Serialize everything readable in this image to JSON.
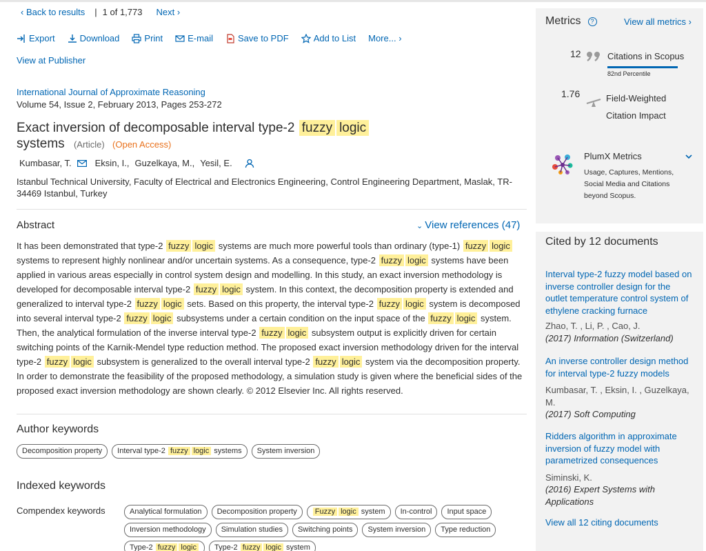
{
  "nav": {
    "back": "Back to results",
    "position": "1",
    "of_label": "of",
    "total": "1,773",
    "next": "Next"
  },
  "toolbar": {
    "export": "Export",
    "download": "Download",
    "print": "Print",
    "email": "E-mail",
    "save_pdf": "Save to PDF",
    "add_list": "Add to List",
    "more": "More..."
  },
  "view_publisher": "View at Publisher",
  "journal": "International Journal of Approximate Reasoning",
  "volume": "Volume 54, Issue 2, February 2013, Pages 253-272",
  "title": {
    "part1": "Exact inversion of decomposable interval type-2",
    "hl1": "fuzzy",
    "hl2": "logic",
    "part2": "systems",
    "article": "(Article)",
    "open_access": "(Open Access)"
  },
  "authors": [
    "Kumbasar, T.",
    "Eksin, I.,",
    "Guzelkaya, M.,",
    "Yesil, E."
  ],
  "affiliation": "Istanbul Technical University, Faculty of Electrical and Electronics Engineering, Control Engineering Department, Maslak, TR-34469 Istanbul, Turkey",
  "abstract": {
    "heading": "Abstract",
    "view_refs": "View references (47)",
    "segments": [
      {
        "t": "It has been demonstrated that type-2 "
      },
      {
        "h": "fuzzy"
      },
      {
        "h": "logic"
      },
      {
        "t": " systems are much more powerful tools than ordinary (type-1) "
      },
      {
        "h": "fuzzy"
      },
      {
        "h": "logic"
      },
      {
        "t": " systems to represent highly nonlinear and/or uncertain systems. As a consequence, type-2 "
      },
      {
        "h": "fuzzy"
      },
      {
        "h": "logic"
      },
      {
        "t": " systems have been applied in various areas especially in control system design and modelling. In this study, an exact inversion methodology is developed for decomposable interval type-2 "
      },
      {
        "h": "fuzzy"
      },
      {
        "h": "logic"
      },
      {
        "t": " system. In this context, the decomposition property is extended and generalized to interval type-2 "
      },
      {
        "h": "fuzzy"
      },
      {
        "h": "logic"
      },
      {
        "t": " sets. Based on this property, the interval type-2 "
      },
      {
        "h": "fuzzy"
      },
      {
        "h": "logic"
      },
      {
        "t": " system is decomposed into several interval type-2 "
      },
      {
        "h": "fuzzy"
      },
      {
        "h": "logic"
      },
      {
        "t": " subsystems under a certain condition on the input space of the "
      },
      {
        "h": "fuzzy"
      },
      {
        "h": "logic"
      },
      {
        "t": " system. Then, the analytical formulation of the inverse interval type-2 "
      },
      {
        "h": "fuzzy"
      },
      {
        "h": "logic"
      },
      {
        "t": " subsystem output is explicitly driven for certain switching points of the Karnik-Mendel type reduction method. The proposed exact inversion methodology driven for the interval type-2 "
      },
      {
        "h": "fuzzy"
      },
      {
        "h": "logic"
      },
      {
        "t": " subsystem is generalized to the overall interval type-2 "
      },
      {
        "h": "fuzzy"
      },
      {
        "h": "logic"
      },
      {
        "t": " system via the decomposition property. In order to demonstrate the feasibility of the proposed methodology, a simulation study is given where the beneficial sides of the proposed exact inversion methodology are shown clearly. © 2012 Elsevier Inc. All rights reserved."
      }
    ]
  },
  "author_keywords": {
    "heading": "Author keywords",
    "items": [
      [
        {
          "t": "Decomposition property"
        }
      ],
      [
        {
          "t": "Interval type-2 "
        },
        {
          "h": "fuzzy"
        },
        {
          "h": "logic"
        },
        {
          "t": " systems"
        }
      ],
      [
        {
          "t": "System inversion"
        }
      ]
    ]
  },
  "indexed_keywords": {
    "heading": "Indexed keywords",
    "compendex_label": "Compendex keywords",
    "items": [
      [
        {
          "t": "Analytical formulation"
        }
      ],
      [
        {
          "t": "Decomposition property"
        }
      ],
      [
        {
          "h": "Fuzzy"
        },
        {
          "h": "logic"
        },
        {
          "t": " system"
        }
      ],
      [
        {
          "t": "In-control"
        }
      ],
      [
        {
          "t": "Input space"
        }
      ],
      [
        {
          "t": "Inversion methodology"
        }
      ],
      [
        {
          "t": "Simulation studies"
        }
      ],
      [
        {
          "t": "Switching points"
        }
      ],
      [
        {
          "t": "System inversion"
        }
      ],
      [
        {
          "t": "Type reduction"
        }
      ],
      [
        {
          "t": "Type-2 "
        },
        {
          "h": "fuzzy"
        },
        {
          "h": "logic"
        }
      ],
      [
        {
          "t": "Type-2 "
        },
        {
          "h": "fuzzy"
        },
        {
          "h": "logic"
        },
        {
          "t": " system"
        }
      ]
    ]
  },
  "metrics": {
    "heading": "Metrics",
    "view_all": "View all metrics",
    "citations": "12",
    "citations_label": "Citations in Scopus",
    "percentile": "82nd Percentile",
    "fwci": "1.76",
    "fwci_label": "Field-Weighted Citation Impact",
    "plumx": "PlumX Metrics",
    "plumx_desc": "Usage, Captures, Mentions, Social Media and Citations beyond Scopus."
  },
  "cited_by": {
    "heading": "Cited by 12 documents",
    "view_all": "View all 12 citing documents",
    "docs": [
      {
        "title": "Interval type-2 fuzzy model based on inverse controller design for the outlet temperature control system of ethylene cracking furnace",
        "authors": "Zhao, T. , Li, P. , Cao, J.",
        "source": "(2017) Information (Switzerland)"
      },
      {
        "title": "An inverse controller design method for interval type-2 fuzzy models",
        "authors": "Kumbasar, T. , Eksin, I. , Guzelkaya, M.",
        "source": "(2017) Soft Computing"
      },
      {
        "title": "Ridders algorithm in approximate inversion of fuzzy model with parametrized consequences",
        "authors": "Siminski, K.",
        "source": "(2016) Expert Systems with Applications"
      }
    ]
  }
}
